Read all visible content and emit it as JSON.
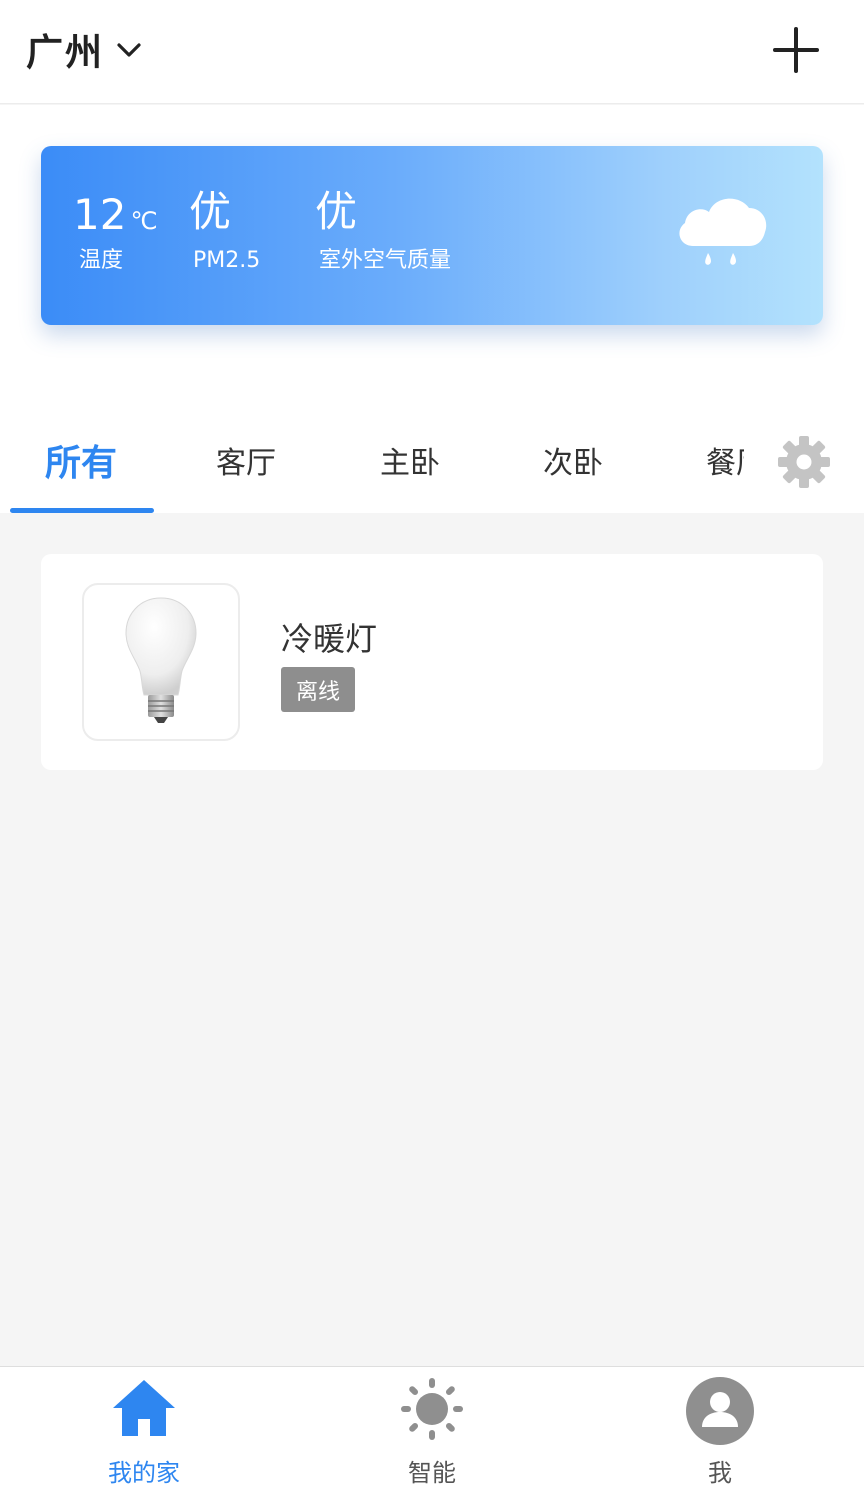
{
  "header": {
    "city": "广州",
    "add_icon": "plus-icon",
    "dropdown_icon": "chevron-down-icon"
  },
  "weather": {
    "temperature": "12",
    "temperature_unit": "℃",
    "temperature_label": "温度",
    "pm25_value": "优",
    "pm25_label": "PM2.5",
    "air_quality_value": "优",
    "air_quality_label": "室外空气质量",
    "icon": "rain-cloud-icon"
  },
  "tabs": {
    "items": [
      {
        "label": "所有",
        "active": true
      },
      {
        "label": "客厅",
        "active": false
      },
      {
        "label": "主卧",
        "active": false
      },
      {
        "label": "次卧",
        "active": false
      },
      {
        "label": "餐厅",
        "active": false
      }
    ],
    "settings_icon": "gear-icon"
  },
  "devices": [
    {
      "name": "冷暖灯",
      "status": "离线",
      "icon": "light-bulb-icon"
    }
  ],
  "bottom_nav": {
    "items": [
      {
        "label": "我的家",
        "icon": "home-icon",
        "active": true
      },
      {
        "label": "智能",
        "icon": "sun-icon",
        "active": false
      },
      {
        "label": "我",
        "icon": "user-icon",
        "active": false
      }
    ]
  },
  "colors": {
    "accent": "#2e86f0",
    "offline_badge": "#8e8e8e",
    "background": "#f5f5f5"
  }
}
